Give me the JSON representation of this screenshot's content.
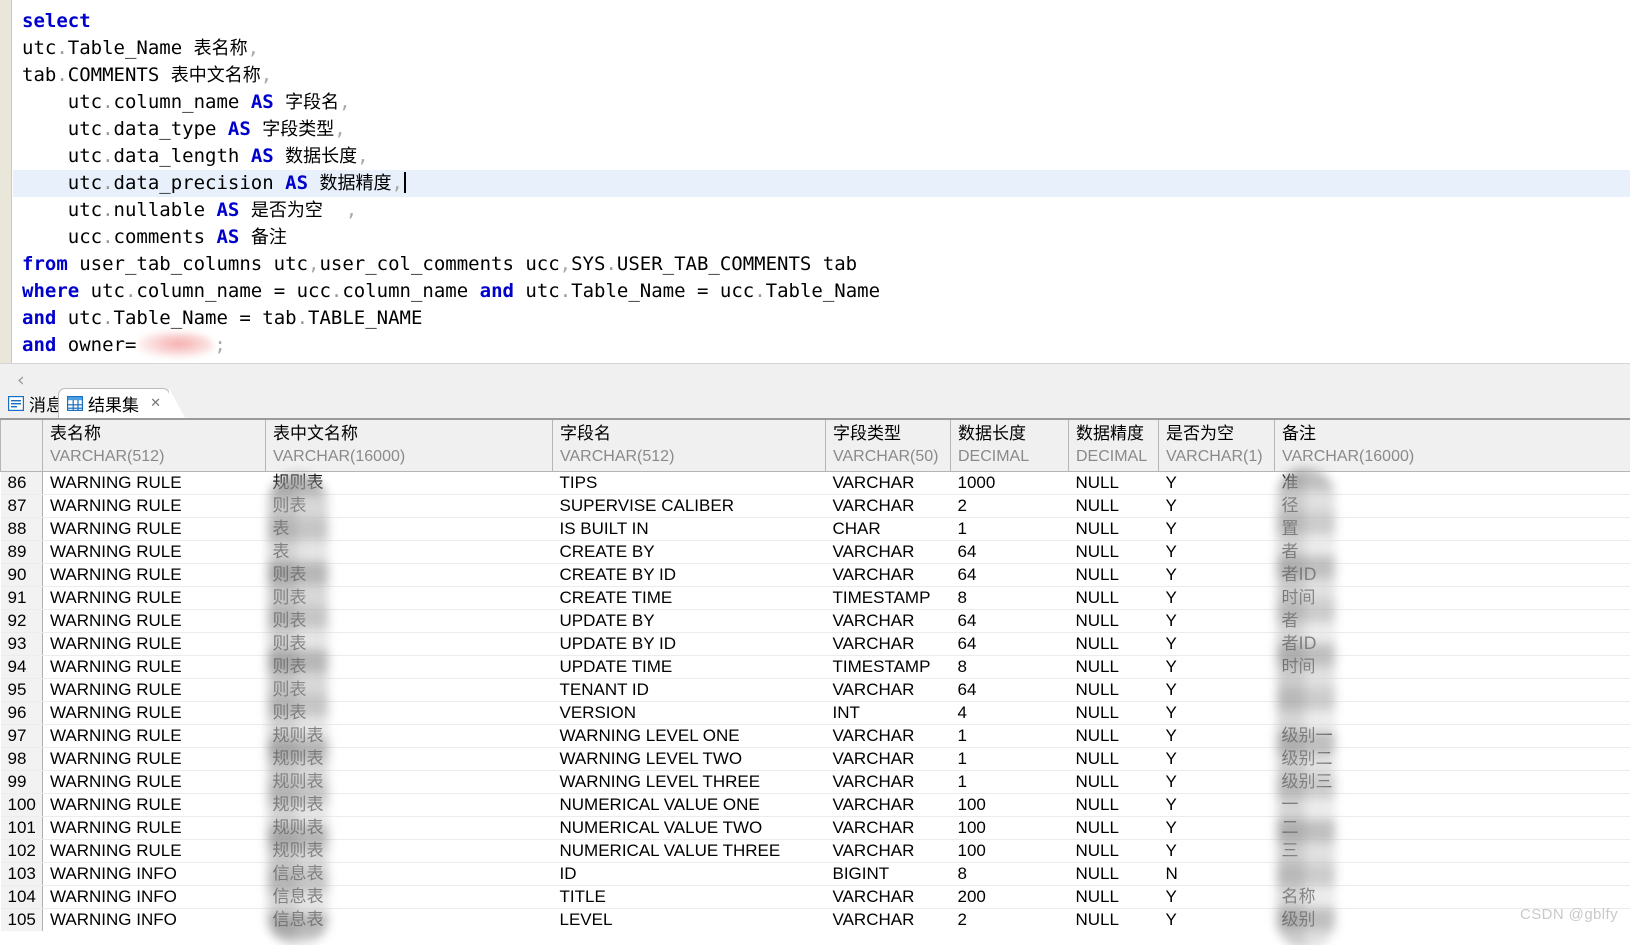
{
  "editor": {
    "lines": [
      [
        {
          "t": "select",
          "c": "kw"
        }
      ],
      [
        {
          "t": "utc",
          "c": ""
        },
        {
          "t": ".",
          "c": "dot"
        },
        {
          "t": "Table_Name ",
          "c": ""
        },
        {
          "t": "表名称",
          "c": "cn"
        },
        {
          "t": ",",
          "c": "punc"
        }
      ],
      [
        {
          "t": "tab",
          "c": ""
        },
        {
          "t": ".",
          "c": "dot"
        },
        {
          "t": "COMMENTS ",
          "c": ""
        },
        {
          "t": "表中文名称",
          "c": "cn"
        },
        {
          "t": ",",
          "c": "punc"
        }
      ],
      [
        {
          "t": "    utc",
          "c": ""
        },
        {
          "t": ".",
          "c": "dot"
        },
        {
          "t": "column_name ",
          "c": ""
        },
        {
          "t": "AS",
          "c": "kw"
        },
        {
          "t": " ",
          "c": ""
        },
        {
          "t": "字段名",
          "c": "cn"
        },
        {
          "t": ",",
          "c": "punc"
        }
      ],
      [
        {
          "t": "    utc",
          "c": ""
        },
        {
          "t": ".",
          "c": "dot"
        },
        {
          "t": "data_type ",
          "c": ""
        },
        {
          "t": "AS",
          "c": "kw"
        },
        {
          "t": " ",
          "c": ""
        },
        {
          "t": "字段类型",
          "c": "cn"
        },
        {
          "t": ",",
          "c": "punc"
        }
      ],
      [
        {
          "t": "    utc",
          "c": ""
        },
        {
          "t": ".",
          "c": "dot"
        },
        {
          "t": "data_length ",
          "c": ""
        },
        {
          "t": "AS",
          "c": "kw"
        },
        {
          "t": " ",
          "c": ""
        },
        {
          "t": "数据长度",
          "c": "cn"
        },
        {
          "t": ",",
          "c": "punc"
        }
      ],
      [
        {
          "t": "    utc",
          "c": ""
        },
        {
          "t": ".",
          "c": "dot"
        },
        {
          "t": "data_precision ",
          "c": ""
        },
        {
          "t": "AS",
          "c": "kw"
        },
        {
          "t": " ",
          "c": ""
        },
        {
          "t": "数据精度",
          "c": "cn"
        },
        {
          "t": ",",
          "c": "punc"
        }
      ],
      [
        {
          "t": "    utc",
          "c": ""
        },
        {
          "t": ".",
          "c": "dot"
        },
        {
          "t": "nullable ",
          "c": ""
        },
        {
          "t": "AS",
          "c": "kw"
        },
        {
          "t": " ",
          "c": ""
        },
        {
          "t": "是否为空",
          "c": "cn"
        },
        {
          "t": "  ,",
          "c": "punc"
        }
      ],
      [
        {
          "t": "    ucc",
          "c": ""
        },
        {
          "t": ".",
          "c": "dot"
        },
        {
          "t": "comments ",
          "c": ""
        },
        {
          "t": "AS",
          "c": "kw"
        },
        {
          "t": " ",
          "c": ""
        },
        {
          "t": "备注",
          "c": "cn"
        }
      ],
      [
        {
          "t": "from",
          "c": "kw"
        },
        {
          "t": " user_tab_columns utc",
          "c": ""
        },
        {
          "t": ",",
          "c": "punc"
        },
        {
          "t": "user_col_comments ucc",
          "c": ""
        },
        {
          "t": ",",
          "c": "punc"
        },
        {
          "t": "SYS",
          "c": ""
        },
        {
          "t": ".",
          "c": "dot"
        },
        {
          "t": "USER_TAB_COMMENTS tab",
          "c": ""
        }
      ],
      [
        {
          "t": "where",
          "c": "kw"
        },
        {
          "t": " utc",
          "c": ""
        },
        {
          "t": ".",
          "c": "dot"
        },
        {
          "t": "column_name = ucc",
          "c": ""
        },
        {
          "t": ".",
          "c": "dot"
        },
        {
          "t": "column_name ",
          "c": ""
        },
        {
          "t": "and",
          "c": "kw"
        },
        {
          "t": " utc",
          "c": ""
        },
        {
          "t": ".",
          "c": "dot"
        },
        {
          "t": "Table_Name = ucc",
          "c": ""
        },
        {
          "t": ".",
          "c": "dot"
        },
        {
          "t": "Table_Name",
          "c": ""
        }
      ],
      [
        {
          "t": "and",
          "c": "kw"
        },
        {
          "t": " utc",
          "c": ""
        },
        {
          "t": ".",
          "c": "dot"
        },
        {
          "t": "Table_Name = tab",
          "c": ""
        },
        {
          "t": ".",
          "c": "dot"
        },
        {
          "t": "TABLE_NAME",
          "c": ""
        }
      ],
      [
        {
          "t": "and",
          "c": "kw"
        },
        {
          "t": " owner=",
          "c": ""
        },
        {
          "t": "__BLUR__",
          "c": "blur"
        },
        {
          "t": ";",
          "c": "punc"
        }
      ]
    ],
    "current_line_index": 6,
    "scroll_left_chevron": "‹"
  },
  "tabs": [
    {
      "label": "消息",
      "icon": "message-icon",
      "active": false,
      "closable": false
    },
    {
      "label": "结果集",
      "icon": "grid-icon",
      "active": true,
      "closable": true,
      "close_glyph": "✕"
    }
  ],
  "grid": {
    "columns": [
      {
        "name": "表名称",
        "type": "VARCHAR(512)"
      },
      {
        "name": "表中文名称",
        "type": "VARCHAR(16000)"
      },
      {
        "name": "字段名",
        "type": "VARCHAR(512)"
      },
      {
        "name": "字段类型",
        "type": "VARCHAR(50)"
      },
      {
        "name": "数据长度",
        "type": "DECIMAL"
      },
      {
        "name": "数据精度",
        "type": "DECIMAL"
      },
      {
        "name": "是否为空",
        "type": "VARCHAR(1)"
      },
      {
        "name": "备注",
        "type": "VARCHAR(16000)"
      }
    ],
    "rows": [
      {
        "n": "86",
        "table": "WARNING RULE",
        "tabcn": "规则表",
        "field": "TIPS",
        "type": "VARCHAR",
        "len": "1000",
        "prec": "NULL",
        "nullable": "Y",
        "comment": "准"
      },
      {
        "n": "87",
        "table": "WARNING RULE",
        "tabcn": "则表",
        "field": "SUPERVISE CALIBER",
        "type": "VARCHAR",
        "len": "2",
        "prec": "NULL",
        "nullable": "Y",
        "comment": "径"
      },
      {
        "n": "88",
        "table": "WARNING RULE",
        "tabcn": "表",
        "field": "IS BUILT IN",
        "type": "CHAR",
        "len": "1",
        "prec": "NULL",
        "nullable": "Y",
        "comment": "置"
      },
      {
        "n": "89",
        "table": "WARNING RULE",
        "tabcn": "表",
        "field": "CREATE BY",
        "type": "VARCHAR",
        "len": "64",
        "prec": "NULL",
        "nullable": "Y",
        "comment": "者"
      },
      {
        "n": "90",
        "table": "WARNING RULE",
        "tabcn": "则表",
        "field": "CREATE BY ID",
        "type": "VARCHAR",
        "len": "64",
        "prec": "NULL",
        "nullable": "Y",
        "comment": "者ID"
      },
      {
        "n": "91",
        "table": "WARNING RULE",
        "tabcn": "则表",
        "field": "CREATE TIME",
        "type": "TIMESTAMP",
        "len": "8",
        "prec": "NULL",
        "nullable": "Y",
        "comment": "时间"
      },
      {
        "n": "92",
        "table": "WARNING RULE",
        "tabcn": "则表",
        "field": "UPDATE BY",
        "type": "VARCHAR",
        "len": "64",
        "prec": "NULL",
        "nullable": "Y",
        "comment": "者"
      },
      {
        "n": "93",
        "table": "WARNING RULE",
        "tabcn": "则表",
        "field": "UPDATE BY ID",
        "type": "VARCHAR",
        "len": "64",
        "prec": "NULL",
        "nullable": "Y",
        "comment": "者ID"
      },
      {
        "n": "94",
        "table": "WARNING RULE",
        "tabcn": "则表",
        "field": "UPDATE TIME",
        "type": "TIMESTAMP",
        "len": "8",
        "prec": "NULL",
        "nullable": "Y",
        "comment": "时间"
      },
      {
        "n": "95",
        "table": "WARNING RULE",
        "tabcn": "则表",
        "field": "TENANT ID",
        "type": "VARCHAR",
        "len": "64",
        "prec": "NULL",
        "nullable": "Y",
        "comment": ""
      },
      {
        "n": "96",
        "table": "WARNING RULE",
        "tabcn": "则表",
        "field": "VERSION",
        "type": "INT",
        "len": "4",
        "prec": "NULL",
        "nullable": "Y",
        "comment": ""
      },
      {
        "n": "97",
        "table": "WARNING RULE",
        "tabcn": "规则表",
        "field": "WARNING LEVEL ONE",
        "type": "VARCHAR",
        "len": "1",
        "prec": "NULL",
        "nullable": "Y",
        "comment": "级别一"
      },
      {
        "n": "98",
        "table": "WARNING RULE",
        "tabcn": "规则表",
        "field": "WARNING LEVEL TWO",
        "type": "VARCHAR",
        "len": "1",
        "prec": "NULL",
        "nullable": "Y",
        "comment": "级别二"
      },
      {
        "n": "99",
        "table": "WARNING RULE",
        "tabcn": "规则表",
        "field": "WARNING LEVEL THREE",
        "type": "VARCHAR",
        "len": "1",
        "prec": "NULL",
        "nullable": "Y",
        "comment": "级别三"
      },
      {
        "n": "100",
        "table": "WARNING RULE",
        "tabcn": "规则表",
        "field": "NUMERICAL VALUE ONE",
        "type": "VARCHAR",
        "len": "100",
        "prec": "NULL",
        "nullable": "Y",
        "comment": "一"
      },
      {
        "n": "101",
        "table": "WARNING RULE",
        "tabcn": "规则表",
        "field": "NUMERICAL VALUE TWO",
        "type": "VARCHAR",
        "len": "100",
        "prec": "NULL",
        "nullable": "Y",
        "comment": "二"
      },
      {
        "n": "102",
        "table": "WARNING RULE",
        "tabcn": "规则表",
        "field": "NUMERICAL VALUE THREE",
        "type": "VARCHAR",
        "len": "100",
        "prec": "NULL",
        "nullable": "Y",
        "comment": "三"
      },
      {
        "n": "103",
        "table": "WARNING INFO",
        "tabcn": "信息表",
        "field": "ID",
        "type": "BIGINT",
        "len": "8",
        "prec": "NULL",
        "nullable": "N",
        "comment": ""
      },
      {
        "n": "104",
        "table": "WARNING INFO",
        "tabcn": "信息表",
        "field": "TITLE",
        "type": "VARCHAR",
        "len": "200",
        "prec": "NULL",
        "nullable": "Y",
        "comment": "名称"
      },
      {
        "n": "105",
        "table": "WARNING INFO",
        "tabcn": "信息表",
        "field": "LEVEL",
        "type": "VARCHAR",
        "len": "2",
        "prec": "NULL",
        "nullable": "Y",
        "comment": "级别"
      }
    ]
  },
  "watermark": "CSDN @gblfy"
}
